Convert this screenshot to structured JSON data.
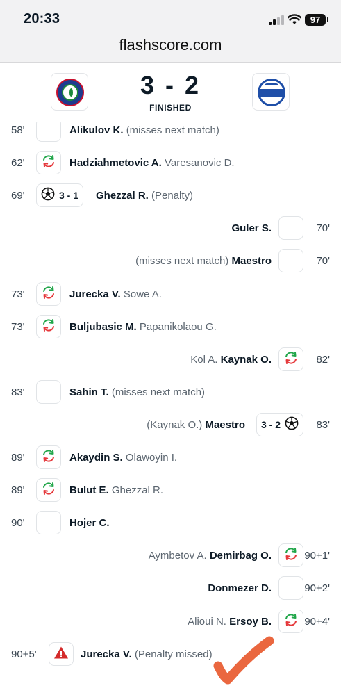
{
  "status_bar": {
    "time": "20:33",
    "battery": "97"
  },
  "browser": {
    "url": "flashscore.com"
  },
  "match": {
    "score": "3 - 2",
    "status": "FINISHED"
  },
  "events": [
    {
      "side": "home",
      "minute": "58'",
      "type": "yellow-card",
      "player": "Alikulov K.",
      "detail": "(misses next match)"
    },
    {
      "side": "home",
      "minute": "62'",
      "type": "substitution",
      "player": "Hadziahmetovic A.",
      "detail": "Varesanovic D."
    },
    {
      "side": "home",
      "minute": "69'",
      "type": "goal",
      "score": "3 - 1",
      "player": "Ghezzal R.",
      "detail": "(Penalty)"
    },
    {
      "side": "away",
      "minute": "70'",
      "type": "yellow-card",
      "player": "Guler S.",
      "detail": ""
    },
    {
      "side": "away",
      "minute": "70'",
      "type": "yellow-card",
      "player": "Maestro",
      "detail": "(misses next match)"
    },
    {
      "side": "home",
      "minute": "73'",
      "type": "substitution",
      "player": "Jurecka V.",
      "detail": "Sowe A."
    },
    {
      "side": "home",
      "minute": "73'",
      "type": "substitution",
      "player": "Buljubasic M.",
      "detail": "Papanikolaou G."
    },
    {
      "side": "away",
      "minute": "82'",
      "type": "substitution",
      "player": "Kaynak O.",
      "detail": "Kol A."
    },
    {
      "side": "home",
      "minute": "83'",
      "type": "yellow-card",
      "player": "Sahin T.",
      "detail": "(misses next match)"
    },
    {
      "side": "away",
      "minute": "83'",
      "type": "goal",
      "score": "3 - 2",
      "player": "Maestro",
      "detail": "(Kaynak O.)"
    },
    {
      "side": "home",
      "minute": "89'",
      "type": "substitution",
      "player": "Akaydin S.",
      "detail": "Olawoyin I."
    },
    {
      "side": "home",
      "minute": "89'",
      "type": "substitution",
      "player": "Bulut E.",
      "detail": "Ghezzal R."
    },
    {
      "side": "home",
      "minute": "90'",
      "type": "yellow-card",
      "player": "Hojer C.",
      "detail": ""
    },
    {
      "side": "away",
      "minute": "90+1'",
      "type": "substitution",
      "player": "Demirbag O.",
      "detail": "Aymbetov A."
    },
    {
      "side": "away",
      "minute": "90+2'",
      "type": "yellow-card",
      "player": "Donmezer D.",
      "detail": ""
    },
    {
      "side": "away",
      "minute": "90+4'",
      "type": "substitution",
      "player": "Ersoy B.",
      "detail": "Alioui N."
    },
    {
      "side": "home",
      "minute": "90+5'",
      "type": "missed-penalty",
      "player": "Jurecka V.",
      "detail": "(Penalty missed)"
    }
  ],
  "colors": {
    "yellow_card": "#f9d230",
    "sub_in": "#21a64a",
    "sub_out": "#e5383b",
    "missed_penalty": "#d42a2a",
    "check_mark": "#e8572a"
  },
  "icons": {
    "yellow-card": "yellow-card-icon",
    "substitution": "substitution-icon",
    "goal": "soccer-ball-icon",
    "missed-penalty": "warning-icon"
  }
}
